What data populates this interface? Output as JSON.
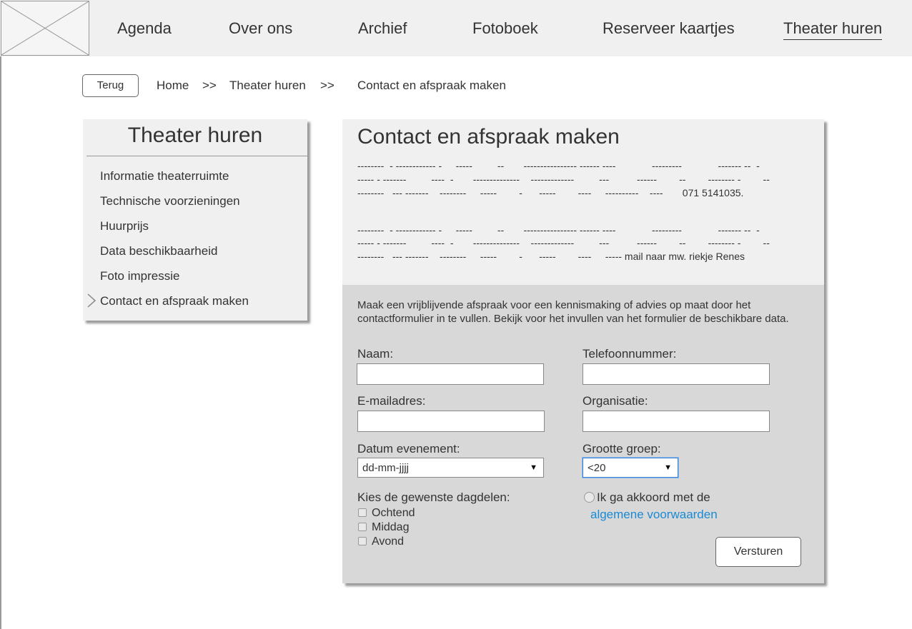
{
  "nav": {
    "items": [
      "Agenda",
      "Over ons",
      "Archief",
      "Fotoboek",
      "Reserveer kaartjes",
      "Theater huren"
    ],
    "active": "Theater huren"
  },
  "back_button": "Terug",
  "breadcrumb": {
    "items": [
      "Home",
      "Theater huren",
      "Contact en afspraak maken"
    ],
    "separator": ">>"
  },
  "sidebar": {
    "title": "Theater huren",
    "items": [
      "Informatie theaterruimte",
      "Technische voorzieningen",
      "Huurprijs",
      "Data beschikbaarheid",
      "Foto impressie",
      "Contact en afspraak maken"
    ],
    "selected_icon": "chevron-right-icon"
  },
  "main": {
    "title": "Contact en afspraak maken",
    "phone_block": {
      "line1": "--------  - ------------ -     -----         --       ---------------- ------ ----             ---------             ------- --  -",
      "line2": "----- - -------         ----  -       --------------    -------------         ---          ------        --        -------- -        --",
      "line3": "--------   --- -------    --------     -----        -      -----        ----     ----------    ----       071 5141035."
    },
    "mail_block": {
      "line1": "--------  - ------------ -     -----         --       ---------------- ------ ----             ---------             ------- --  -",
      "line2": "----- - -------         ----  -       --------------    -------------         ---          ------        --        -------- -        --",
      "line3": "--------   --- -------    --------     -----        -      -----        ----     ----- mail naar mw. riekje Renes"
    },
    "form": {
      "intro": "Maak een vrijblijvende afspraak voor een kennismaking of advies op maat door het contactformulier in te vullen. Bekijk voor het invullen van het formulier de beschikbare data.",
      "name_label": "Naam:",
      "name_value": "",
      "phone_label": "Telefoonnummer:",
      "phone_value": "",
      "email_label": "E-mailadres:",
      "email_value": "",
      "org_label": "Organisatie:",
      "org_value": "",
      "date_label": "Datum evenement:",
      "date_value": "dd-mm-jjjj",
      "group_label": "Grootte groep:",
      "group_value": "<20",
      "dayparts_label": "Kies de gewenste dagdelen:",
      "dayparts": [
        "Ochtend",
        "Middag",
        "Avond"
      ],
      "agree_text": "Ik ga akkoord met de",
      "terms_link": "algemene voorwaarden",
      "submit": "Versturen"
    }
  },
  "colors": {
    "topbar_bg": "#f0f0f0",
    "panel_bg": "#f0f0f0",
    "form_bg": "#d8d8d8",
    "link": "#1a8ad4",
    "focus_border": "#3b82d6"
  }
}
